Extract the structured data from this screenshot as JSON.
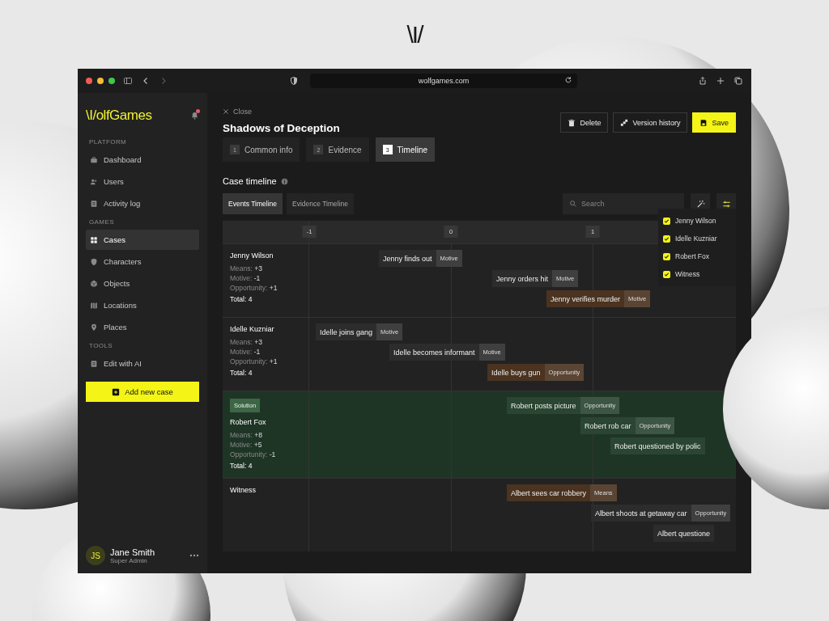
{
  "brand_mark": "\\I/",
  "browser": {
    "url": "wolfgames.com"
  },
  "sidebar": {
    "logo": "\\I/olfGames",
    "notification": true,
    "sections": [
      {
        "title": "PLATFORM",
        "items": [
          {
            "label": "Dashboard",
            "selected": false
          },
          {
            "label": "Users",
            "selected": false
          },
          {
            "label": "Activity log",
            "selected": false
          }
        ]
      },
      {
        "title": "GAMES",
        "items": [
          {
            "label": "Cases",
            "selected": true
          },
          {
            "label": "Characters",
            "selected": false
          },
          {
            "label": "Objects",
            "selected": false
          },
          {
            "label": "Locations",
            "selected": false
          },
          {
            "label": "Places",
            "selected": false
          }
        ]
      },
      {
        "title": "TOOLS",
        "items": [
          {
            "label": "Edit with AI",
            "selected": false
          }
        ]
      }
    ],
    "add_button": "Add new case",
    "user": {
      "initials": "JS",
      "name": "Jane Smith",
      "role": "Super Admin"
    }
  },
  "header": {
    "close": "Close",
    "title": "Shadows of Deception",
    "actions": [
      {
        "label": "Delete",
        "kind": "secondary"
      },
      {
        "label": "Version history",
        "kind": "secondary"
      },
      {
        "label": "Save",
        "kind": "primary"
      }
    ]
  },
  "steps": [
    {
      "number": "1",
      "label": "Common info",
      "selected": false
    },
    {
      "number": "2",
      "label": "Evidence",
      "selected": false
    },
    {
      "number": "3",
      "label": "Timeline",
      "selected": true
    }
  ],
  "section_title": "Case timeline",
  "view_tabs": [
    {
      "label": "Events Timeline",
      "selected": true
    },
    {
      "label": "Evidence Timeline",
      "selected": false
    }
  ],
  "search": {
    "placeholder": "Search"
  },
  "filter": {
    "open": true,
    "options": [
      {
        "label": "Jenny Wilson",
        "checked": true
      },
      {
        "label": "Idelle Kuzniar",
        "checked": true
      },
      {
        "label": "Robert Fox",
        "checked": true
      },
      {
        "label": "Witness",
        "checked": true
      }
    ]
  },
  "timeline": {
    "ticks": [
      "-1",
      "0",
      "1"
    ],
    "rows": [
      {
        "name": "Jenny Wilson",
        "solution": false,
        "stats": [
          {
            "label": "Means:",
            "value": "+3"
          },
          {
            "label": "Motive:",
            "value": "-1"
          },
          {
            "label": "Opportunity:",
            "value": "+1"
          }
        ],
        "total": "Total: 4",
        "events": [
          {
            "title": "Jenny finds out",
            "tag": "Motive",
            "color": "#2c2c2c"
          },
          {
            "title": "Jenny orders hit",
            "tag": "Motive",
            "color": "#2c2c2c"
          },
          {
            "title": "Jenny verifies murder",
            "tag": "Motive",
            "color": "#4a3320"
          }
        ]
      },
      {
        "name": "Idelle Kuzniar",
        "solution": false,
        "stats": [
          {
            "label": "Means:",
            "value": "+3"
          },
          {
            "label": "Motive:",
            "value": "-1"
          },
          {
            "label": "Opportunity:",
            "value": "+1"
          }
        ],
        "total": "Total: 4",
        "events": [
          {
            "title": "Idelle joins gang",
            "tag": "Motive",
            "color": "#2c2c2c"
          },
          {
            "title": "Idelle becomes informant",
            "tag": "Motive",
            "color": "#2c2c2c"
          },
          {
            "title": "Idelle buys gun",
            "tag": "Opportunity",
            "color": "#4a3320"
          }
        ]
      },
      {
        "name": "Robert Fox",
        "solution": true,
        "badge": "Solution",
        "stats": [
          {
            "label": "Means:",
            "value": "+8"
          },
          {
            "label": "Motive:",
            "value": "+5"
          },
          {
            "label": "Opportunity:",
            "value": "-1"
          }
        ],
        "total": "Total: 4",
        "events": [
          {
            "title": "Robert posts picture",
            "tag": "Opportunity",
            "color": "#2a4531"
          },
          {
            "title": "Robert rob car",
            "tag": "Opportunity",
            "color": "#2a4531"
          },
          {
            "title": "Robert questioned by polic",
            "color": "#2a4531"
          }
        ]
      },
      {
        "name": "Witness",
        "solution": false,
        "events": [
          {
            "title": "Albert sees car robbery",
            "tag": "Means",
            "color": "#4a3320"
          },
          {
            "title": "Albert shoots at getaway car",
            "tag": "Opportunity",
            "color": "#2c2c2c"
          },
          {
            "title": "Albert questione",
            "color": "#2c2c2c"
          }
        ]
      }
    ]
  }
}
